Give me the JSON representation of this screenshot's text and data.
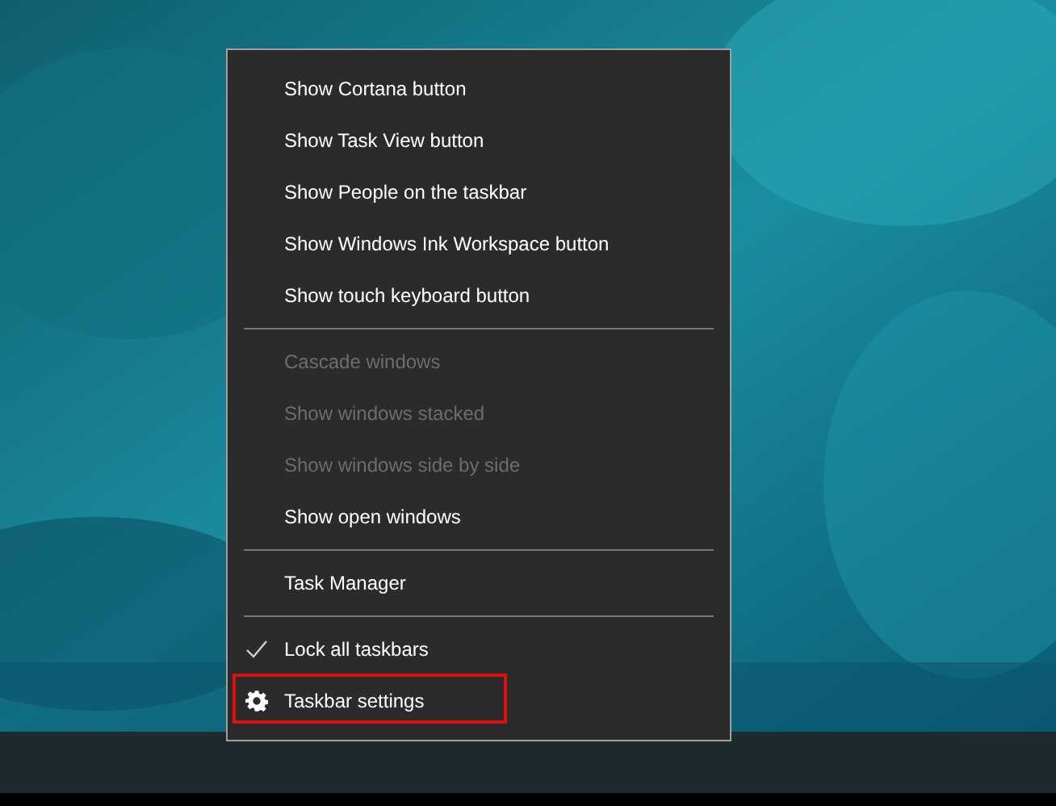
{
  "context_menu": {
    "items": [
      {
        "kind": "item",
        "label": "Show Cortana button",
        "disabled": false,
        "checked": false,
        "highlighted": false
      },
      {
        "kind": "item",
        "label": "Show Task View button",
        "disabled": false,
        "checked": false,
        "highlighted": false
      },
      {
        "kind": "item",
        "label": "Show People on the taskbar",
        "disabled": false,
        "checked": false,
        "highlighted": false
      },
      {
        "kind": "item",
        "label": "Show Windows Ink Workspace button",
        "disabled": false,
        "checked": false,
        "highlighted": false
      },
      {
        "kind": "item",
        "label": "Show touch keyboard button",
        "disabled": false,
        "checked": false,
        "highlighted": false
      },
      {
        "kind": "separator"
      },
      {
        "kind": "item",
        "label": "Cascade windows",
        "disabled": true,
        "checked": false,
        "highlighted": false
      },
      {
        "kind": "item",
        "label": "Show windows stacked",
        "disabled": true,
        "checked": false,
        "highlighted": false
      },
      {
        "kind": "item",
        "label": "Show windows side by side",
        "disabled": true,
        "checked": false,
        "highlighted": false
      },
      {
        "kind": "item",
        "label": "Show open windows",
        "disabled": false,
        "checked": false,
        "highlighted": false
      },
      {
        "kind": "separator"
      },
      {
        "kind": "item",
        "label": "Task Manager",
        "disabled": false,
        "checked": false,
        "highlighted": false
      },
      {
        "kind": "separator"
      },
      {
        "kind": "item",
        "label": "Lock all taskbars",
        "disabled": false,
        "checked": true,
        "highlighted": false
      },
      {
        "kind": "settings",
        "label": "Taskbar settings",
        "disabled": false,
        "checked": false,
        "highlighted": true
      }
    ]
  }
}
